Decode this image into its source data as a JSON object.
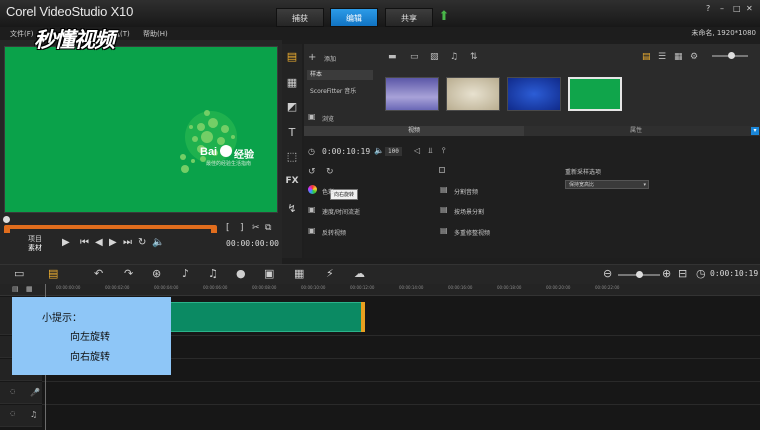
{
  "app": {
    "title": "Corel VideoStudio X10",
    "project_info": "未命名, 1920*1080"
  },
  "main_tabs": [
    "捕获",
    "编辑",
    "共享"
  ],
  "menu": [
    "文件(F)",
    "工具(T)",
    "帮助(H)"
  ],
  "watermark": "秒懂视频",
  "preview": {
    "logo": "Bai",
    "logo_suffix": "经验",
    "tagline": "最佳的经验生活指南",
    "mode_project": "项目",
    "mode_clip": "素材",
    "timecode": "00:00:00:00"
  },
  "library": {
    "add_label": "添加",
    "sample_label": "样本",
    "scorefitter_label": "ScoreFitter 音乐",
    "browse_label": "浏览"
  },
  "options": {
    "tabs": [
      "视频",
      "属性"
    ],
    "timecode": "0:00:10:19",
    "volume": "100",
    "tooltip": "向右旋转",
    "color_label": "色彩",
    "speed_label": "速度/时间流逝",
    "reverse_label": "反转视频",
    "split_audio_label": "分割音频",
    "split_scene_label": "按场景分割",
    "multi_trim_label": "多重修整视频",
    "resample_label": "重新采样选项",
    "resample_value": "保持宽高比"
  },
  "timeline": {
    "timecode": "0:00:10:19",
    "ruler": [
      "00:00:00:00",
      "00:00:02:00",
      "00:00:04:00",
      "00:00:06:00",
      "00:00:08:00",
      "00:00:10:00",
      "00:00:12:00",
      "00:00:14:00",
      "00:00:16:00",
      "00:00:18:00",
      "00:00:20:00",
      "00:00:22:00"
    ]
  },
  "tip": {
    "title": "小提示：",
    "line1": "向左旋转",
    "line2": "向右旋转"
  },
  "colors": {
    "accent_blue": "#1a86d8",
    "preview_green": "#0aa24a",
    "scrub_orange": "#e16d1d",
    "tip_bg": "#8ec6f7"
  }
}
